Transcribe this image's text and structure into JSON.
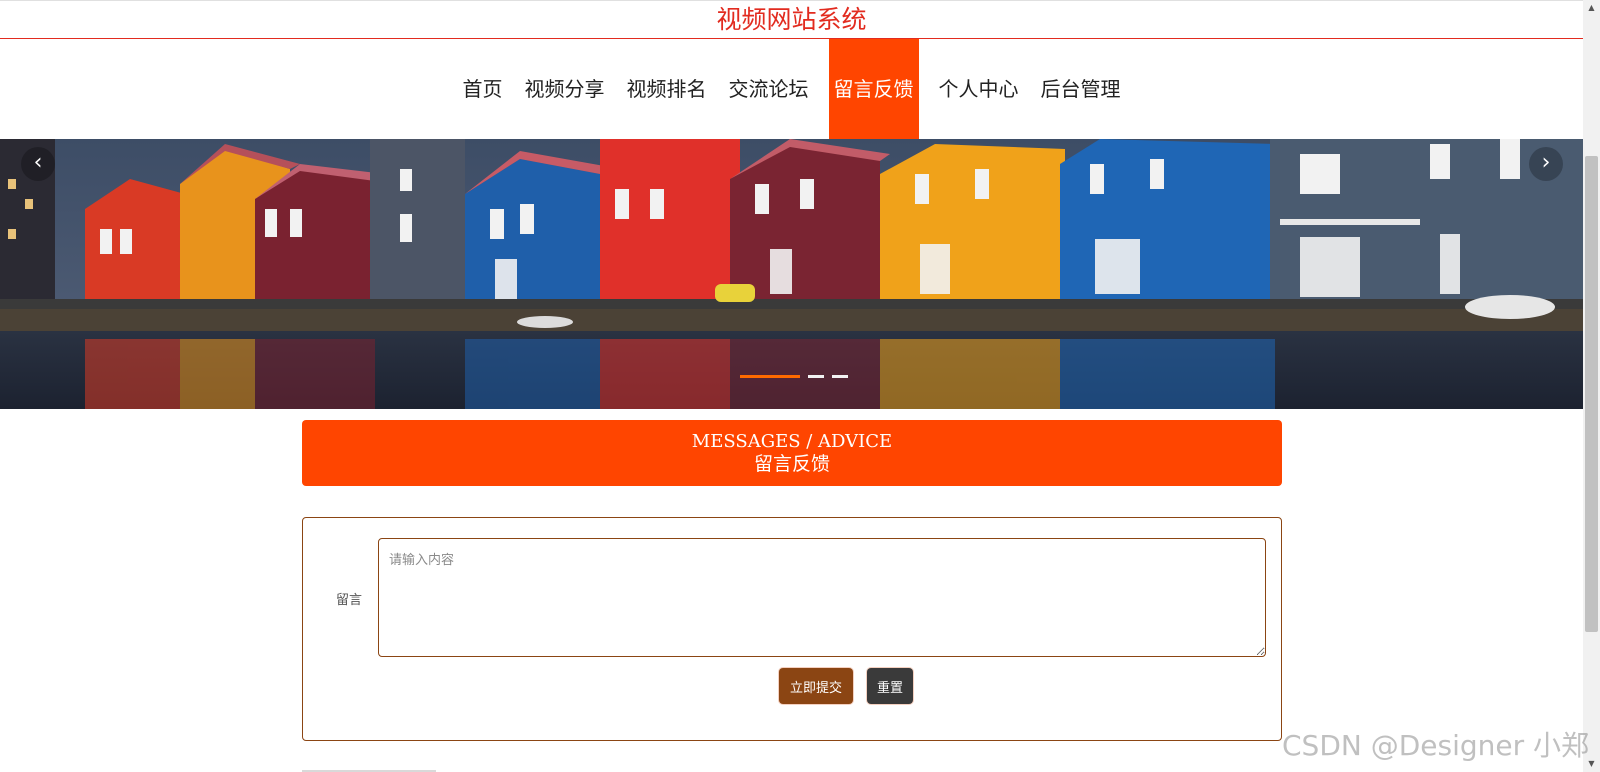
{
  "site": {
    "title": "视频网站系统"
  },
  "nav": {
    "items": [
      {
        "label": "首页"
      },
      {
        "label": "视频分享"
      },
      {
        "label": "视频排名"
      },
      {
        "label": "交流论坛"
      },
      {
        "label": "留言反馈",
        "active": true
      },
      {
        "label": "个人中心"
      },
      {
        "label": "后台管理"
      }
    ],
    "active_color": "#ff4500"
  },
  "banner": {
    "prev_icon": "chevron-left-icon",
    "next_icon": "chevron-right-icon",
    "prev_glyph": "‹",
    "next_glyph": "›",
    "slide_count": 3,
    "active_slide": 1
  },
  "section": {
    "title_en": "MESSAGES / ADVICE",
    "title_zh": "留言反馈"
  },
  "form": {
    "label": "留言",
    "placeholder": "请输入内容",
    "value": "",
    "submit_label": "立即提交",
    "reset_label": "重置",
    "submit_color": "#8b4513",
    "reset_color": "#3a3a3a"
  },
  "scrollbar": {
    "up_glyph": "▲",
    "down_glyph": "▼"
  },
  "watermark": "CSDN @Designer 小郑",
  "colors": {
    "title_red": "#e22b1f",
    "accent": "#ff4500",
    "border_brown": "#8b4513"
  }
}
